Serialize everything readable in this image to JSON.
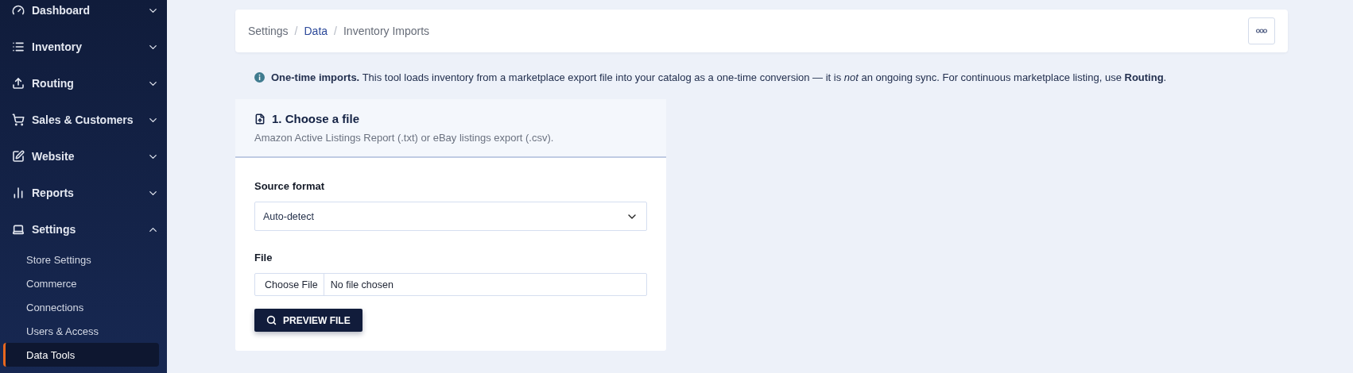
{
  "sidebar": {
    "items": [
      {
        "label": "Dashboard",
        "expanded": false
      },
      {
        "label": "Inventory",
        "expanded": false
      },
      {
        "label": "Routing",
        "expanded": false
      },
      {
        "label": "Sales & Customers",
        "expanded": false
      },
      {
        "label": "Website",
        "expanded": false
      },
      {
        "label": "Reports",
        "expanded": false
      },
      {
        "label": "Settings",
        "expanded": true,
        "children": [
          {
            "label": "Store Settings",
            "selected": false
          },
          {
            "label": "Commerce",
            "selected": false
          },
          {
            "label": "Connections",
            "selected": false
          },
          {
            "label": "Users & Access",
            "selected": false
          },
          {
            "label": "Data Tools",
            "selected": true
          }
        ]
      }
    ]
  },
  "breadcrumb": [
    {
      "label": "Settings",
      "link": false
    },
    {
      "separator": "/",
      "label": "Data",
      "link": true
    },
    {
      "separator": "/",
      "label": "Inventory Imports",
      "link": false
    }
  ],
  "notice": "**One-time imports.** This tool loads inventory from a marketplace export file into your catalog as a one-time conversion — it is *not* an ongoing sync. For continuous marketplace listing, use **Routing**.",
  "card": {
    "title": "1. Choose a file",
    "subtitle": "Amazon Active Listings Report (.txt) or eBay listings export (.csv).",
    "source_format": {
      "label": "Source format",
      "value": "Auto-detect"
    },
    "file": {
      "label": "File",
      "button": "Choose File",
      "value": "No file chosen"
    },
    "action": "PREVIEW FILE"
  }
}
